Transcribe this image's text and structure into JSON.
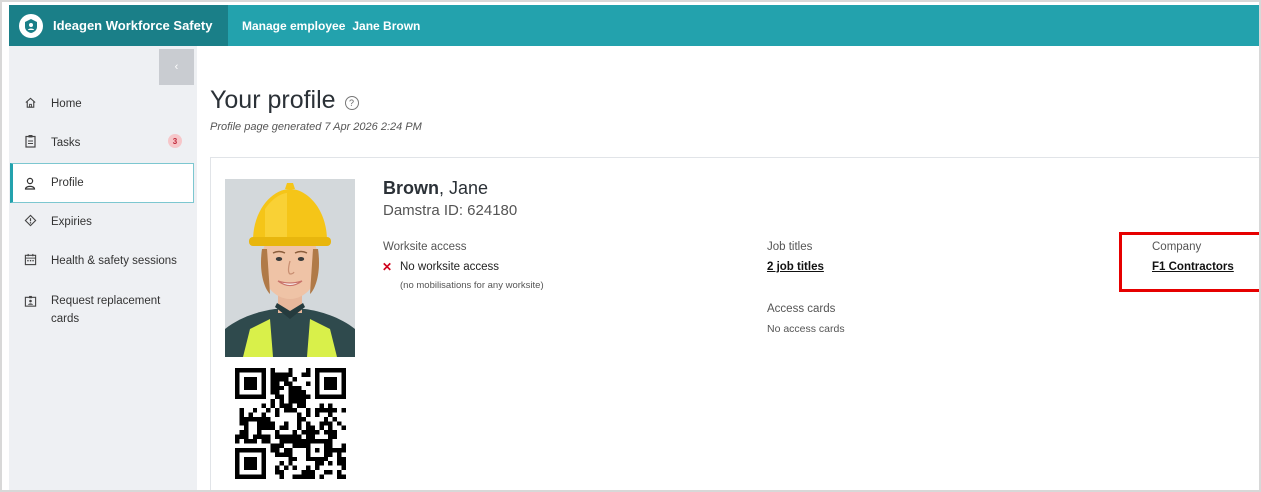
{
  "header": {
    "app_title": "Ideagen Workforce Safety",
    "breadcrumb_section": "Manage employee",
    "breadcrumb_name": "Jane Brown"
  },
  "sidebar": {
    "collapse_label": "‹",
    "items": [
      {
        "label": "Home",
        "icon": "home-icon"
      },
      {
        "label": "Tasks",
        "icon": "clipboard-icon",
        "badge": "3"
      },
      {
        "label": "Profile",
        "icon": "user-icon",
        "active": true
      },
      {
        "label": "Expiries",
        "icon": "diamond-warning-icon"
      },
      {
        "label": "Health & safety sessions",
        "icon": "calendar-icon"
      },
      {
        "label": "Request replacement cards",
        "icon": "id-card-icon"
      }
    ]
  },
  "main": {
    "title": "Your profile",
    "help_label": "?",
    "generated": "Profile page generated 7 Apr 2026 2:24 PM"
  },
  "profile": {
    "last_name": "Brown",
    "first_name": "Jane",
    "damstra_id": "Damstra ID: 624180",
    "worksite_access_label": "Worksite access",
    "worksite_access_value": "No worksite access",
    "worksite_access_note": "(no mobilisations for any worksite)",
    "job_titles_label": "Job titles",
    "job_titles_link": "2 job titles",
    "access_cards_label": "Access cards",
    "access_cards_value": "No access cards",
    "company_label": "Company",
    "company_link": "F1 Contractors"
  },
  "colors": {
    "header": "#23a2ad",
    "brand": "#1a7f88",
    "highlight": "#e60000",
    "error": "#d0021b"
  }
}
